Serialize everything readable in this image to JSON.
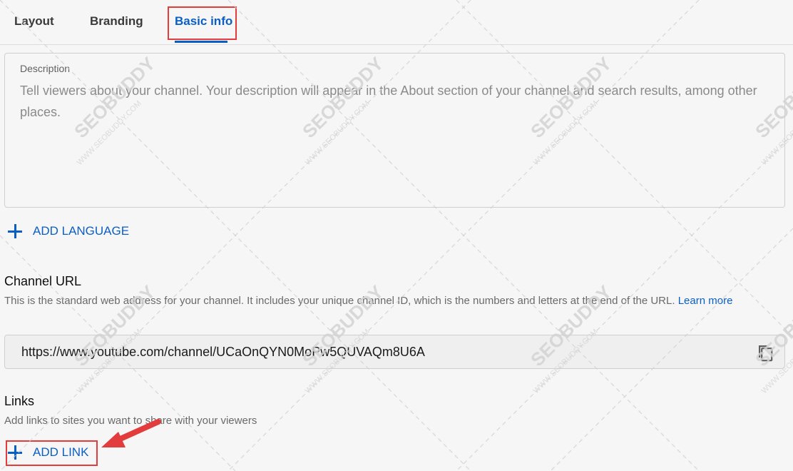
{
  "tabs": [
    {
      "label": "Layout",
      "active": false
    },
    {
      "label": "Branding",
      "active": false
    },
    {
      "label": "Basic info",
      "active": true
    }
  ],
  "description": {
    "label": "Description",
    "placeholder": "Tell viewers about your channel. Your description will appear in the About section of your channel and search results, among other places."
  },
  "add_language": {
    "label": "ADD LANGUAGE",
    "icon": "plus-icon"
  },
  "channel_url": {
    "title": "Channel URL",
    "help_text": "This is the standard web address for your channel. It includes your unique channel ID, which is the numbers and letters at the end of the URL. ",
    "learn_more": "Learn more",
    "value": "https://www.youtube.com/channel/UCaOnQYN0MoPw5QUVAQm8U6A",
    "copy_icon": "copy-icon"
  },
  "links": {
    "title": "Links",
    "help_text": "Add links to sites you want to share with your viewers",
    "add_label": "ADD LINK",
    "icon": "plus-icon"
  },
  "watermark": {
    "brand": "SEOBUDDY",
    "site": "WWW.SEOBUDDY.COM"
  },
  "colors": {
    "accent": "#0b5fc4",
    "annotation": "#e23c3c",
    "background": "#f6f6f6"
  }
}
